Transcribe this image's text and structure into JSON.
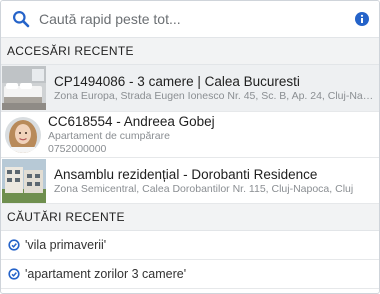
{
  "search": {
    "placeholder": "Caută rapid peste tot...",
    "accent_color": "#2563c9"
  },
  "recent_access": {
    "heading": "ACCESĂRI RECENTE",
    "items": [
      {
        "title": "CP1494086 - 3 camere | Calea Bucuresti",
        "subtitle": "Zona Europa, Strada Eugen Ionesco Nr. 45, Sc. B, Ap. 24, Cluj-Napoca, Cluj",
        "thumb_icon": "bedroom-photo"
      },
      {
        "title": "CC618554 - Andreea Gobej",
        "subtitle": "Apartament de cumpărare",
        "phone": "0752000000",
        "thumb_icon": "contact-avatar"
      },
      {
        "title": "Ansamblu rezidențial - Dorobanti Residence",
        "subtitle": "Zona Semicentral, Calea Dorobantilor Nr. 115, Cluj-Napoca, Cluj",
        "thumb_icon": "building-photo"
      }
    ]
  },
  "recent_searches": {
    "heading": "CĂUTĂRI RECENTE",
    "items": [
      {
        "query": "'vila primaverii'"
      },
      {
        "query": "'apartament zorilor 3 camere'"
      }
    ]
  }
}
